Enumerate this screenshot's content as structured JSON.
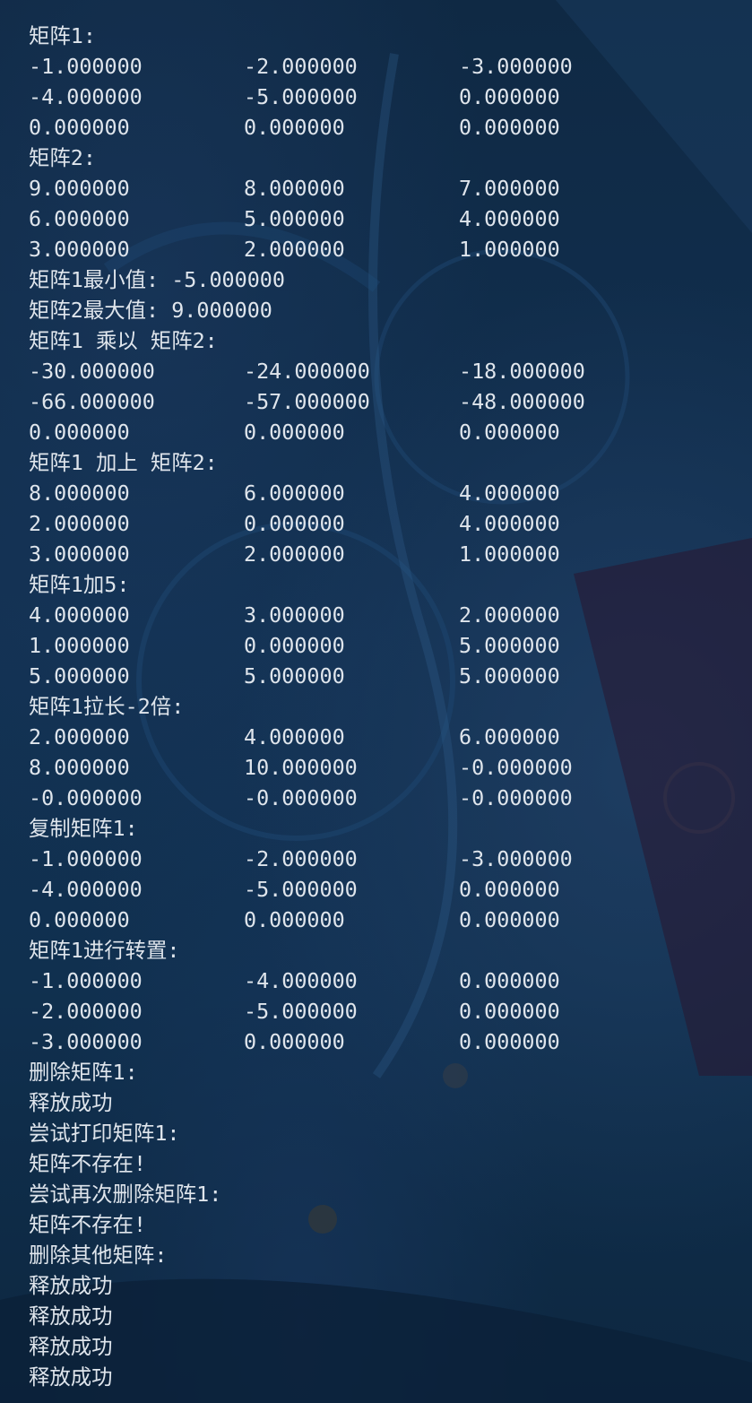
{
  "console": {
    "blocks": [
      {
        "heading": "矩阵1:",
        "rows": [
          [
            "-1.000000",
            "-2.000000",
            "-3.000000"
          ],
          [
            "-4.000000",
            "-5.000000",
            "0.000000"
          ],
          [
            "0.000000",
            "0.000000",
            "0.000000"
          ]
        ]
      },
      {
        "heading": "矩阵2:",
        "rows": [
          [
            "9.000000",
            "8.000000",
            "7.000000"
          ],
          [
            "6.000000",
            "5.000000",
            "4.000000"
          ],
          [
            "3.000000",
            "2.000000",
            "1.000000"
          ]
        ]
      },
      {
        "heading": "矩阵1最小值: -5.000000",
        "rows": []
      },
      {
        "heading": "矩阵2最大值: 9.000000",
        "rows": []
      },
      {
        "heading": "矩阵1 乘以 矩阵2:",
        "rows": [
          [
            "-30.000000",
            "-24.000000",
            "-18.000000"
          ],
          [
            "-66.000000",
            "-57.000000",
            "-48.000000"
          ],
          [
            "0.000000",
            "0.000000",
            "0.000000"
          ]
        ]
      },
      {
        "heading": "矩阵1 加上 矩阵2:",
        "rows": [
          [
            "8.000000",
            "6.000000",
            "4.000000"
          ],
          [
            "2.000000",
            "0.000000",
            "4.000000"
          ],
          [
            "3.000000",
            "2.000000",
            "1.000000"
          ]
        ]
      },
      {
        "heading": "矩阵1加5:",
        "rows": [
          [
            "4.000000",
            "3.000000",
            "2.000000"
          ],
          [
            "1.000000",
            "0.000000",
            "5.000000"
          ],
          [
            "5.000000",
            "5.000000",
            "5.000000"
          ]
        ]
      },
      {
        "heading": "矩阵1拉长-2倍:",
        "rows": [
          [
            "2.000000",
            "4.000000",
            "6.000000"
          ],
          [
            "8.000000",
            "10.000000",
            "-0.000000"
          ],
          [
            "-0.000000",
            "-0.000000",
            "-0.000000"
          ]
        ]
      },
      {
        "heading": "复制矩阵1:",
        "rows": [
          [
            "-1.000000",
            "-2.000000",
            "-3.000000"
          ],
          [
            "-4.000000",
            "-5.000000",
            "0.000000"
          ],
          [
            "0.000000",
            "0.000000",
            "0.000000"
          ]
        ]
      },
      {
        "heading": "矩阵1进行转置:",
        "rows": [
          [
            "-1.000000",
            "-4.000000",
            "0.000000"
          ],
          [
            "-2.000000",
            "-5.000000",
            "0.000000"
          ],
          [
            "-3.000000",
            "0.000000",
            "0.000000"
          ]
        ]
      },
      {
        "heading": "删除矩阵1:",
        "rows": []
      },
      {
        "heading": "释放成功",
        "rows": []
      },
      {
        "heading": "尝试打印矩阵1:",
        "rows": []
      },
      {
        "heading": "矩阵不存在!",
        "rows": []
      },
      {
        "heading": "尝试再次删除矩阵1:",
        "rows": []
      },
      {
        "heading": "矩阵不存在!",
        "rows": []
      },
      {
        "heading": "删除其他矩阵:",
        "rows": []
      },
      {
        "heading": "释放成功",
        "rows": []
      },
      {
        "heading": "释放成功",
        "rows": []
      },
      {
        "heading": "释放成功",
        "rows": []
      },
      {
        "heading": "释放成功",
        "rows": []
      }
    ]
  },
  "colors": {
    "text": "#dfe5ec",
    "background": "#102a47"
  }
}
